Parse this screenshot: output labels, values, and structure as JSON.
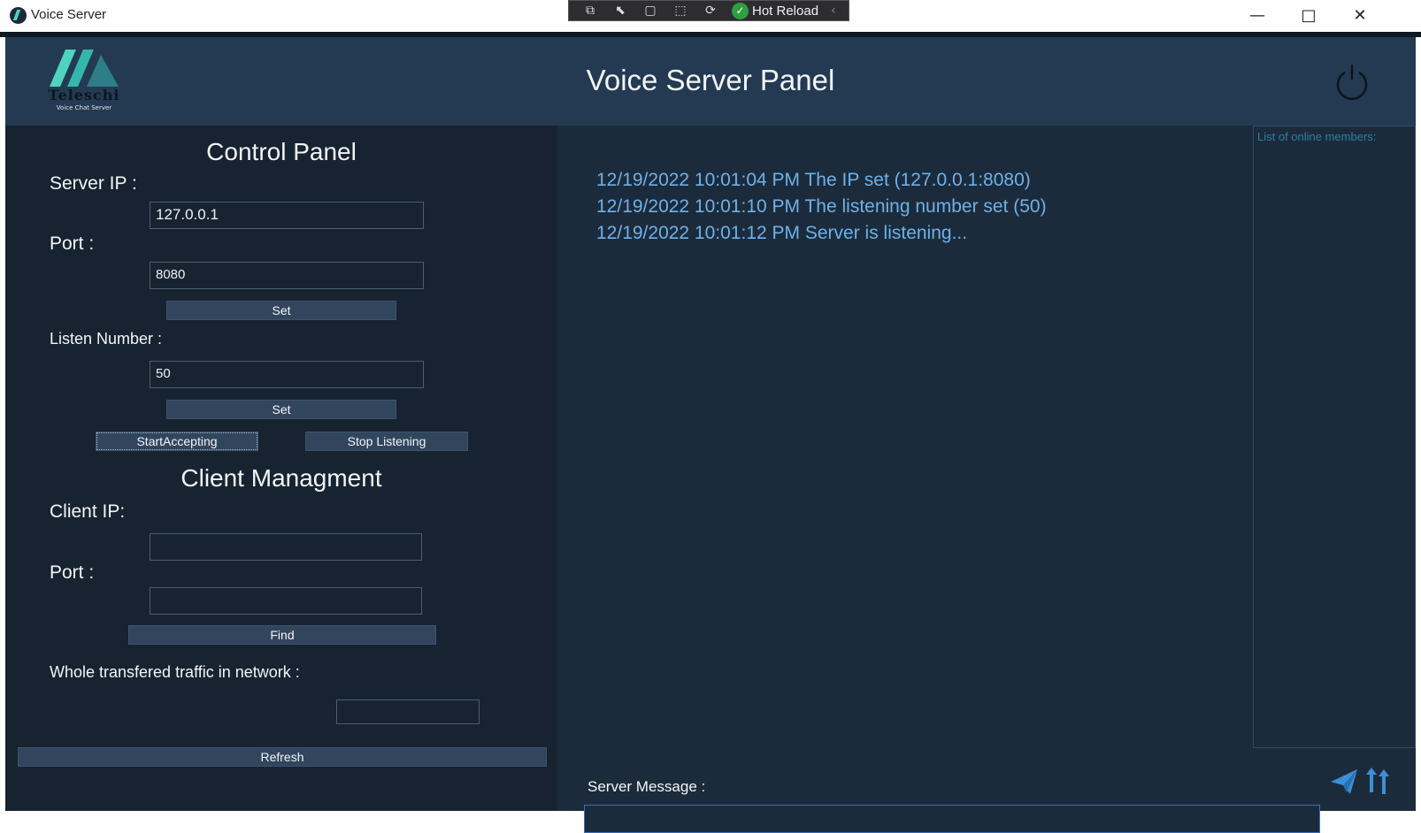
{
  "window": {
    "title": "Voice Server",
    "controls": {
      "minimize": "—",
      "maximize": "□",
      "close": "✕"
    }
  },
  "hot_reload": {
    "label": "Hot Reload"
  },
  "header": {
    "title": "Voice Server Panel",
    "logo_text": "Teleschi",
    "logo_subtitle": "Voice Chat Server"
  },
  "control_panel": {
    "title": "Control Panel",
    "server_ip_label": "Server IP :",
    "server_ip_value": "127.0.0.1",
    "port_label": "Port :",
    "port_value": "8080",
    "set_label": "Set",
    "listen_label": "Listen Number :",
    "listen_value": "50",
    "set2_label": "Set",
    "start_label": "StartAccepting",
    "stop_label": "Stop Listening"
  },
  "client_management": {
    "title": "Client Managment",
    "client_ip_label": "Client IP:",
    "client_ip_value": "",
    "port_label": "Port :",
    "port_value": "",
    "find_label": "Find",
    "traffic_label": "Whole transfered traffic in network :",
    "traffic_value": "",
    "refresh_label": "Refresh"
  },
  "log": [
    "12/19/2022 10:01:04 PM The IP set (127.0.0.1:8080)",
    "12/19/2022 10:01:10 PM The listening number set (50)",
    "12/19/2022 10:01:12 PM Server is listening..."
  ],
  "members": {
    "label": "List of online members:"
  },
  "message": {
    "label": "Server Message :",
    "value": ""
  },
  "colors": {
    "header_bg": "#243a52",
    "left_panel_bg": "#172330",
    "main_bg": "#1c2b3b",
    "log_text": "#6eb1e8",
    "accent": "#3b8fd8",
    "logo_teal": "#4fd2c0"
  }
}
